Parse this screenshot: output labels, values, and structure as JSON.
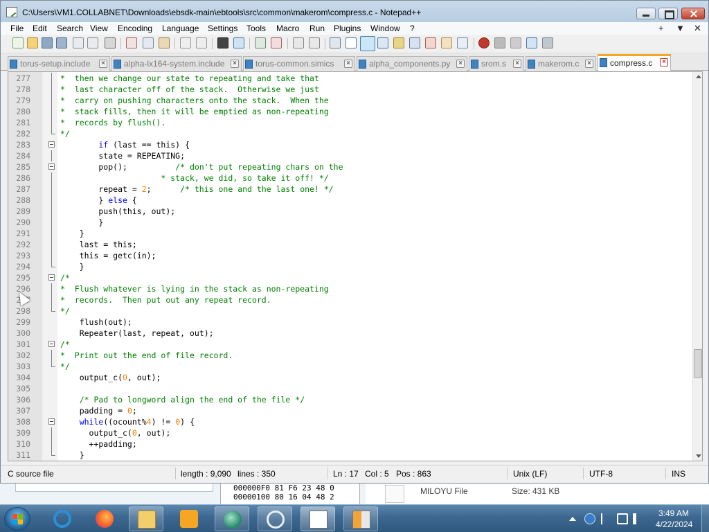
{
  "window": {
    "title": "C:\\Users\\VM1.COLLABNET\\Downloads\\ebsdk-main\\ebtools\\src\\common\\makerom\\compress.c - Notepad++"
  },
  "menu": {
    "items": [
      "File",
      "Edit",
      "Search",
      "View",
      "Encoding",
      "Language",
      "Settings",
      "Tools",
      "Macro",
      "Run",
      "Plugins",
      "Window",
      "?"
    ],
    "right": [
      "+",
      "▼",
      "✕"
    ]
  },
  "toolbar": {
    "icons": [
      "new-file-icon",
      "open-file-icon",
      "save-icon",
      "save-all-icon",
      "close-icon",
      "close-all-icon",
      "print-icon",
      "cut-icon",
      "copy-icon",
      "paste-icon",
      "undo-icon",
      "redo-icon",
      "find-icon",
      "replace-icon",
      "zoom-in-icon",
      "zoom-out-icon",
      "sync-vertical-icon",
      "sync-horizontal-icon",
      "word-wrap-icon",
      "show-all-chars-icon",
      "indent-guide-icon",
      "udl-icon",
      "doc-map-icon",
      "function-list-icon",
      "folder-workspace-icon",
      "monitoring-icon",
      "record-macro-icon",
      "stop-macro-icon",
      "play-macro-icon",
      "run-macro-multiple-icon",
      "save-macro-icon"
    ]
  },
  "tabs": [
    {
      "label": "torus-setup.include",
      "active": false
    },
    {
      "label": "alpha-lx164-system.include",
      "active": false
    },
    {
      "label": "torus-common.simics",
      "active": false
    },
    {
      "label": "alpha_components.py",
      "active": false
    },
    {
      "label": "srom.s",
      "active": false
    },
    {
      "label": "makerom.c",
      "active": false
    },
    {
      "label": "compress.c",
      "active": true
    }
  ],
  "editor": {
    "lines": [
      {
        "num": "277",
        "segments": [
          {
            "t": "*  then we change our state to repeating and take that",
            "c": "cmt"
          }
        ]
      },
      {
        "num": "278",
        "segments": [
          {
            "t": "*  last character off of the stack.  Otherwise we just",
            "c": "cmt"
          }
        ]
      },
      {
        "num": "279",
        "segments": [
          {
            "t": "*  carry on pushing characters onto the stack.  When the",
            "c": "cmt"
          }
        ]
      },
      {
        "num": "280",
        "segments": [
          {
            "t": "*  stack fills, then it will be emptied as non-repeating",
            "c": "cmt"
          }
        ]
      },
      {
        "num": "281",
        "segments": [
          {
            "t": "*  records by flush().",
            "c": "cmt"
          }
        ]
      },
      {
        "num": "282",
        "segments": [
          {
            "t": "*/",
            "c": "cmt"
          }
        ]
      },
      {
        "num": "283",
        "segments": [
          {
            "t": "        if",
            "c": "kw"
          },
          {
            "t": " (last == this) {",
            "c": ""
          }
        ]
      },
      {
        "num": "284",
        "segments": [
          {
            "t": "        state = REPEATING;",
            "c": ""
          }
        ]
      },
      {
        "num": "285",
        "segments": [
          {
            "t": "        pop();          ",
            "c": ""
          },
          {
            "t": "/* don't put repeating chars on the",
            "c": "cmt"
          }
        ]
      },
      {
        "num": "286",
        "segments": [
          {
            "t": "                     * stack, we did, so take it off! */",
            "c": "cmt"
          }
        ]
      },
      {
        "num": "287",
        "segments": [
          {
            "t": "        repeat = ",
            "c": ""
          },
          {
            "t": "2",
            "c": "num"
          },
          {
            "t": ";      ",
            "c": ""
          },
          {
            "t": "/* this one and the last one! */",
            "c": "cmt"
          }
        ]
      },
      {
        "num": "288",
        "segments": [
          {
            "t": "        } ",
            "c": ""
          },
          {
            "t": "else",
            "c": "kw"
          },
          {
            "t": " {",
            "c": ""
          }
        ]
      },
      {
        "num": "289",
        "segments": [
          {
            "t": "        push(this, out);",
            "c": ""
          }
        ]
      },
      {
        "num": "290",
        "segments": [
          {
            "t": "        }",
            "c": ""
          }
        ]
      },
      {
        "num": "291",
        "segments": [
          {
            "t": "    }",
            "c": ""
          }
        ]
      },
      {
        "num": "292",
        "segments": [
          {
            "t": "    last = this;",
            "c": ""
          }
        ]
      },
      {
        "num": "293",
        "segments": [
          {
            "t": "    this = getc(in);",
            "c": ""
          }
        ]
      },
      {
        "num": "294",
        "segments": [
          {
            "t": "    }",
            "c": ""
          }
        ]
      },
      {
        "num": "295",
        "segments": [
          {
            "t": "/*",
            "c": "cmt"
          }
        ]
      },
      {
        "num": "296",
        "segments": [
          {
            "t": "*  Flush whatever is lying in the stack as non-repeating",
            "c": "cmt"
          }
        ]
      },
      {
        "num": "297",
        "segments": [
          {
            "t": "*  records.  Then put out any repeat record.",
            "c": "cmt"
          }
        ]
      },
      {
        "num": "298",
        "segments": [
          {
            "t": "*/",
            "c": "cmt"
          }
        ]
      },
      {
        "num": "299",
        "segments": [
          {
            "t": "    flush(out);",
            "c": ""
          }
        ]
      },
      {
        "num": "300",
        "segments": [
          {
            "t": "    Repeater(last, repeat, out);",
            "c": ""
          }
        ]
      },
      {
        "num": "301",
        "segments": [
          {
            "t": "/*",
            "c": "cmt"
          }
        ]
      },
      {
        "num": "302",
        "segments": [
          {
            "t": "*  Print out the end of file record.",
            "c": "cmt"
          }
        ]
      },
      {
        "num": "303",
        "segments": [
          {
            "t": "*/",
            "c": "cmt"
          }
        ]
      },
      {
        "num": "304",
        "segments": [
          {
            "t": "    output_c(",
            "c": ""
          },
          {
            "t": "0",
            "c": "num"
          },
          {
            "t": ", out);",
            "c": ""
          }
        ]
      },
      {
        "num": "305",
        "segments": [
          {
            "t": "",
            "c": ""
          }
        ]
      },
      {
        "num": "306",
        "segments": [
          {
            "t": "    ",
            "c": ""
          },
          {
            "t": "/* Pad to longword align the end of the file */",
            "c": "cmt"
          }
        ]
      },
      {
        "num": "307",
        "segments": [
          {
            "t": "    padding = ",
            "c": ""
          },
          {
            "t": "0",
            "c": "num"
          },
          {
            "t": ";",
            "c": ""
          }
        ]
      },
      {
        "num": "308",
        "segments": [
          {
            "t": "    while",
            "c": "kw"
          },
          {
            "t": "((ocount%",
            "c": ""
          },
          {
            "t": "4",
            "c": "num"
          },
          {
            "t": ") != ",
            "c": ""
          },
          {
            "t": "0",
            "c": "num"
          },
          {
            "t": ") {",
            "c": ""
          }
        ]
      },
      {
        "num": "309",
        "segments": [
          {
            "t": "      output_c(",
            "c": ""
          },
          {
            "t": "0",
            "c": "num"
          },
          {
            "t": ", out);",
            "c": ""
          }
        ]
      },
      {
        "num": "310",
        "segments": [
          {
            "t": "      ++padding;",
            "c": ""
          }
        ]
      },
      {
        "num": "311",
        "segments": [
          {
            "t": "    }",
            "c": ""
          }
        ]
      }
    ]
  },
  "statusbar": {
    "filetype": "C source file",
    "length": "length : 9,090",
    "lines": "lines : 350",
    "ln": "Ln : 17",
    "col": "Col : 5",
    "pos": "Pos : 863",
    "eol": "Unix (LF)",
    "encoding": "UTF-8",
    "mode": "INS"
  },
  "background": {
    "hex_rows": [
      "000000F0  81 F6 23 48 0",
      "00000100  80 16 04 48 2"
    ],
    "file_name": "MILOYU File",
    "file_size": "Size: 431 KB"
  },
  "taskbar": {
    "apps": [
      "internet-explorer-icon",
      "firefox-icon",
      "file-explorer-icon",
      "media-player-icon",
      "app-green-icon",
      "app-blue-icon",
      "notepad-plus-plus-icon",
      "hxd-icon"
    ],
    "clock_time": "3:49 AM",
    "clock_date": "4/22/2024"
  },
  "colors": {
    "comment": "#008000",
    "keyword": "#0000ff",
    "number": "#ff8000",
    "active_tab_accent": "#f5a623"
  }
}
